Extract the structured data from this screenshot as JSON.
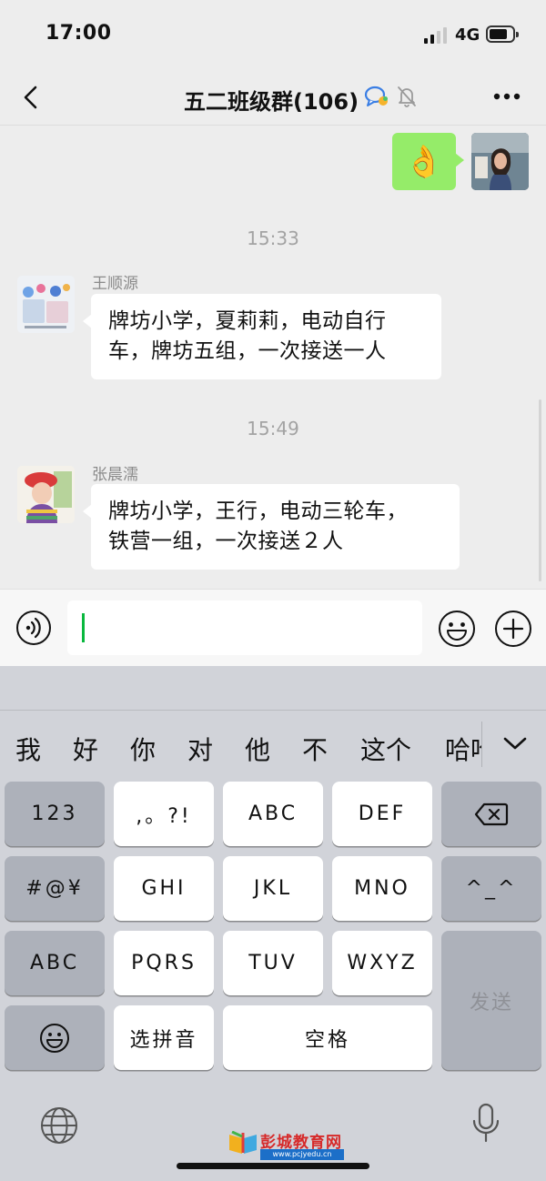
{
  "status_bar": {
    "time": "17:00",
    "network": "4G",
    "signal_bars": 2,
    "signal_total": 4,
    "battery_level": 0.8
  },
  "header": {
    "title": "五二班级群(106)"
  },
  "messages": [
    {
      "type": "sticker",
      "from_me": true,
      "emoji": "👌"
    },
    {
      "type": "timestamp",
      "text": "15:33"
    },
    {
      "type": "text",
      "from_me": false,
      "sender": "王顺源",
      "lines": [
        "牌坊小学，夏莉莉，电动自行",
        "车，牌坊五组，一次接送一人"
      ]
    },
    {
      "type": "timestamp",
      "text": "15:49"
    },
    {
      "type": "text",
      "from_me": false,
      "sender": "张晨濡",
      "lines": [
        "牌坊小学，王行，电动三轮车，",
        "铁营一组，一次接送２人"
      ]
    }
  ],
  "input": {
    "value": ""
  },
  "keyboard": {
    "candidates": [
      "我",
      "好",
      "你",
      "对",
      "他",
      "不",
      "这个",
      "哈哈"
    ],
    "keys": {
      "num": "123",
      "punct": ",。?!",
      "abc_key": "ABC",
      "def_key": "DEF",
      "sym": "#@¥",
      "ghi": "GHI",
      "jkl": "JKL",
      "mno": "MNO",
      "emoticon": "^_^",
      "abc_mode": "ABC",
      "pqrs": "PQRS",
      "tuv": "TUV",
      "wxyz": "WXYZ",
      "send": "发送",
      "pinyin_select": "选拼音",
      "space": "空格"
    }
  },
  "watermark": {
    "title": "彭城教育网",
    "url": "www.pcjyedu.cn"
  },
  "colors": {
    "my_bubble": "#95ec69",
    "cursor": "#09b83e",
    "background": "#ededed"
  }
}
